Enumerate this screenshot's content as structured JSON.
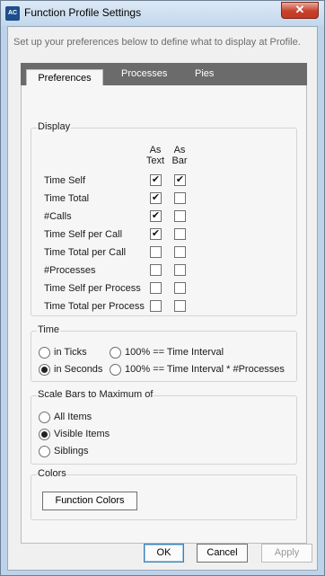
{
  "window": {
    "title": "Function Profile Settings",
    "app_icon": "AC",
    "close_glyph": "✕"
  },
  "intro_text": "Set up your preferences below to define what to display at Profile.",
  "tabs": [
    {
      "label": "Preferences",
      "active": true
    },
    {
      "label": "Processes",
      "active": false
    },
    {
      "label": "Pies",
      "active": false
    }
  ],
  "display": {
    "legend": "Display",
    "col_text": [
      "As",
      "Text"
    ],
    "col_bar": [
      "As",
      "Bar"
    ],
    "rows": [
      {
        "label": "Time Self",
        "text": "✔",
        "bar": "✔"
      },
      {
        "label": "Time Total",
        "text": "✔",
        "bar": ""
      },
      {
        "label": "#Calls",
        "text": "✔",
        "bar": ""
      },
      {
        "label": "Time Self per Call",
        "text": "✔",
        "bar": ""
      },
      {
        "label": "Time Total per Call",
        "text": "",
        "bar": ""
      },
      {
        "label": "#Processes",
        "text": "",
        "bar": ""
      },
      {
        "label": "Time Self per Process",
        "text": "",
        "bar": ""
      },
      {
        "label": "Time Total per Process",
        "text": "",
        "bar": ""
      }
    ]
  },
  "time": {
    "legend": "Time",
    "options": [
      {
        "label": "in Ticks",
        "selected": false
      },
      {
        "label": "100% == Time Interval",
        "selected": false
      },
      {
        "label": "in Seconds",
        "selected": true
      },
      {
        "label": "100% == Time Interval * #Processes",
        "selected": false
      }
    ]
  },
  "scale": {
    "legend": "Scale Bars to Maximum of",
    "options": [
      {
        "label": "All Items",
        "selected": false
      },
      {
        "label": "Visible Items",
        "selected": true
      },
      {
        "label": "Siblings",
        "selected": false
      }
    ]
  },
  "colors": {
    "legend": "Colors",
    "button_label": "Function Colors"
  },
  "footer": {
    "ok_label": "OK",
    "cancel_label": "Cancel",
    "apply_label": "Apply",
    "apply_enabled": false
  }
}
